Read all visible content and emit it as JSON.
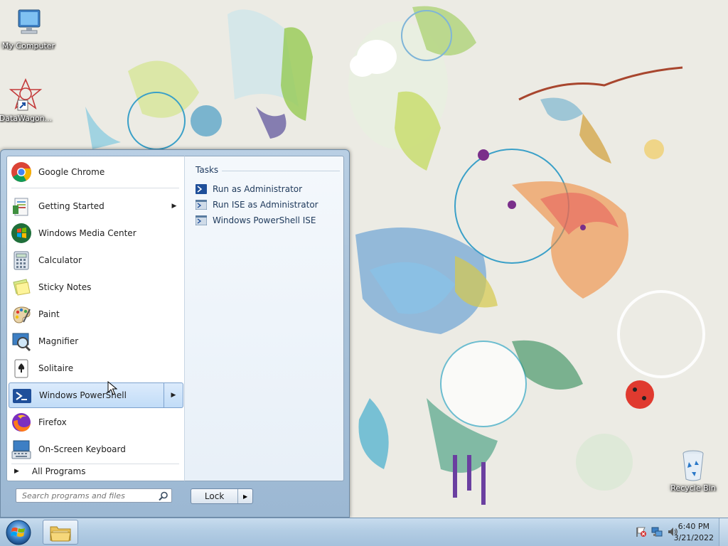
{
  "desktop": {
    "icons": [
      {
        "label": "My Computer",
        "icon": "computer-icon"
      },
      {
        "label": "DataWagon...",
        "icon": "datawagon-icon"
      },
      {
        "label": "Recycle Bin",
        "icon": "recycle-bin-icon"
      }
    ]
  },
  "start_menu": {
    "programs": [
      {
        "label": "Google Chrome",
        "icon": "chrome-icon"
      },
      {
        "label": "Getting Started",
        "icon": "getting-started-icon",
        "has_submenu": true
      },
      {
        "label": "Windows Media Center",
        "icon": "media-center-icon"
      },
      {
        "label": "Calculator",
        "icon": "calculator-icon"
      },
      {
        "label": "Sticky Notes",
        "icon": "sticky-notes-icon"
      },
      {
        "label": "Paint",
        "icon": "paint-icon"
      },
      {
        "label": "Magnifier",
        "icon": "magnifier-icon"
      },
      {
        "label": "Solitaire",
        "icon": "solitaire-icon"
      },
      {
        "label": "Windows PowerShell",
        "icon": "powershell-icon",
        "has_submenu": true,
        "selected": true
      },
      {
        "label": "Firefox",
        "icon": "firefox-icon"
      },
      {
        "label": "On-Screen Keyboard",
        "icon": "keyboard-icon"
      }
    ],
    "all_programs_label": "All Programs",
    "search_placeholder": "Search programs and files",
    "lock_label": "Lock",
    "jump_list": {
      "title": "Tasks",
      "items": [
        {
          "label": "Run as Administrator",
          "icon": "powershell-icon"
        },
        {
          "label": "Run ISE as Administrator",
          "icon": "powershell-ise-icon"
        },
        {
          "label": "Windows PowerShell ISE",
          "icon": "powershell-ise-icon"
        }
      ]
    }
  },
  "taskbar": {
    "clock_time": "6:40 PM",
    "clock_date": "3/21/2022",
    "tray_icons": [
      "action-center-flag-icon",
      "network-icon",
      "volume-icon"
    ]
  },
  "colors": {
    "selection_bg": "#c1dcf7",
    "selection_border": "#7da2ce",
    "taskbar_bg": "#b3cde4",
    "text_dark": "#1e1e1e"
  }
}
